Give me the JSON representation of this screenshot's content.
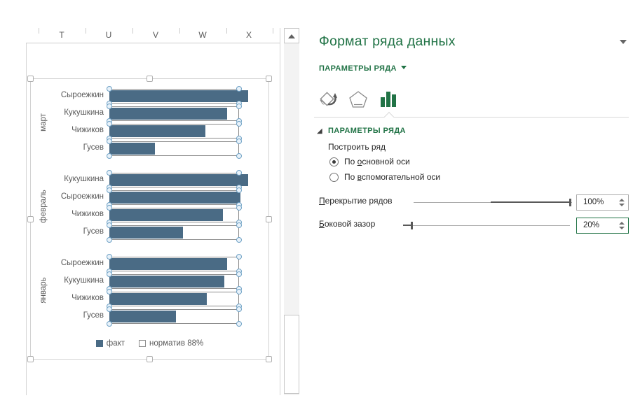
{
  "sheet": {
    "column_headers": [
      "T",
      "U",
      "V",
      "W",
      "X"
    ]
  },
  "chart_data": {
    "type": "bar",
    "orientation": "horizontal",
    "axis_max_percent": 100,
    "normative_percent": 88,
    "groups": [
      {
        "category": "март",
        "rows": [
          {
            "name": "Сыроежкин",
            "fact": 94,
            "normative": 88
          },
          {
            "name": "Кукушкина",
            "fact": 80,
            "normative": 88
          },
          {
            "name": "Чижиков",
            "fact": 65,
            "normative": 88
          },
          {
            "name": "Гусев",
            "fact": 31,
            "normative": 88
          }
        ]
      },
      {
        "category": "февраль",
        "rows": [
          {
            "name": "Кукушкина",
            "fact": 94,
            "normative": 88
          },
          {
            "name": "Сыроежкин",
            "fact": 89,
            "normative": 88
          },
          {
            "name": "Чижиков",
            "fact": 77,
            "normative": 88
          },
          {
            "name": "Гусев",
            "fact": 50,
            "normative": 88
          }
        ]
      },
      {
        "category": "январь",
        "rows": [
          {
            "name": "Сыроежкин",
            "fact": 80,
            "normative": 88
          },
          {
            "name": "Кукушкина",
            "fact": 78,
            "normative": 88
          },
          {
            "name": "Чижиков",
            "fact": 66,
            "normative": 88
          },
          {
            "name": "Гусев",
            "fact": 45,
            "normative": 88
          }
        ]
      }
    ],
    "series": [
      {
        "name": "факт",
        "fill": "#4a6b85",
        "swatch": "filled"
      },
      {
        "name": "норматив 88%",
        "fill": "#ffffff",
        "border": "#8c8c8c",
        "swatch": "outline",
        "selected": true
      }
    ],
    "legend": {
      "position": "bottom",
      "items": [
        "факт",
        "норматив 88%"
      ]
    },
    "colors": {
      "fact": "#4a6b85",
      "normative_border": "#8c8c8c",
      "handle": "#6fa1c5"
    }
  },
  "panel": {
    "title": "Формат ряда данных",
    "subheader": "ПАРАМЕТРЫ РЯДА",
    "section_caret": "◢",
    "tabs": [
      {
        "name": "fill-line",
        "selected": false
      },
      {
        "name": "effects",
        "selected": false
      },
      {
        "name": "series-options",
        "selected": true
      }
    ],
    "section": {
      "header": "ПАРАМЕТРЫ РЯДА",
      "plot_series_label": "Построить ряд",
      "radios": [
        {
          "pre": "По ",
          "accel": "о",
          "post": "сновной оси",
          "selected": true
        },
        {
          "pre": "По ",
          "accel": "в",
          "post": "спомогательной оси",
          "selected": false
        }
      ],
      "sliders": [
        {
          "accel": "П",
          "rest": "ерекрытие рядов",
          "value": "100%"
        },
        {
          "accel": "Б",
          "rest": "оковой зазор",
          "value": "20%"
        }
      ]
    },
    "accent_green": "#217346"
  }
}
